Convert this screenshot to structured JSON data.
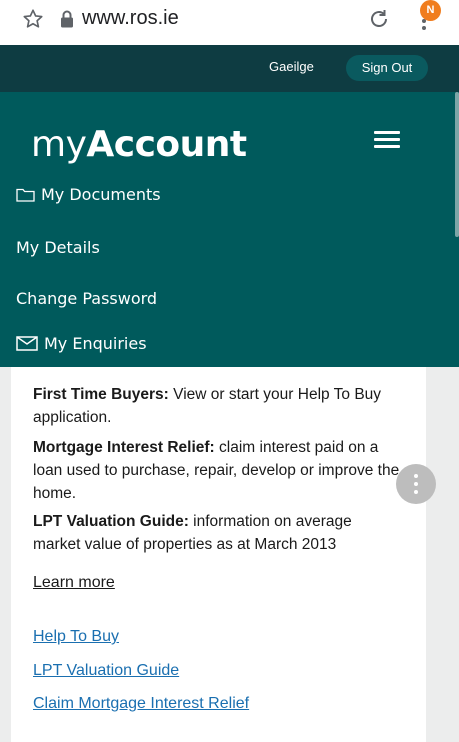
{
  "browser": {
    "url": "www.ros.ie",
    "profile_badge": "N"
  },
  "topbar": {
    "language_link": "Gaeilge",
    "sign_out": "Sign Out"
  },
  "nav": {
    "logo_my": "my",
    "logo_account": "Account",
    "items": [
      {
        "label": "My Documents",
        "icon": "folder-icon"
      },
      {
        "label": "My Details"
      },
      {
        "label": "Change Password"
      },
      {
        "label": "My Enquiries",
        "icon": "envelope-icon"
      }
    ]
  },
  "content": {
    "items": [
      {
        "title": "First Time Buyers:",
        "text": " View or start your Help To Buy application."
      },
      {
        "title": "Mortgage Interest Relief:",
        "text": " claim interest paid on a loan used to purchase, repair, develop or improve the home."
      },
      {
        "title": "LPT Valuation Guide:",
        "text": " information on average market value of properties as at March 2013"
      }
    ],
    "learn_more": "Learn more",
    "links": [
      "Help To Buy",
      "LPT Valuation Guide",
      "Claim Mortgage Interest Relief"
    ]
  },
  "colors": {
    "top_strip": "#0e3c42",
    "nav_bg": "#005a5c",
    "link": "#1a6fb0",
    "badge": "#f07d1e"
  }
}
